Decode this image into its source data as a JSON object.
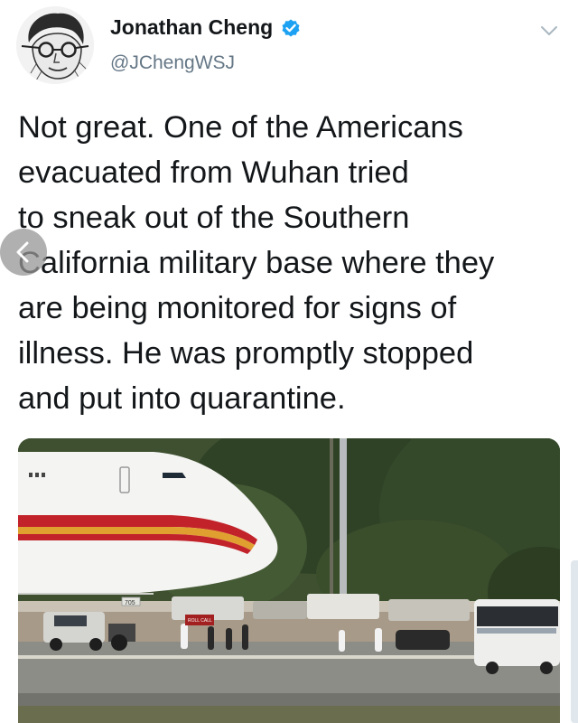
{
  "author": {
    "name": "Jonathan Cheng",
    "handle": "@JChengWSJ",
    "verified": true
  },
  "tweet": {
    "lines": [
      "Not great. One of the Americans",
      "evacuated from Wuhan tried",
      "to sneak out of the Southern",
      "California military base where they",
      "are being monitored for signs of",
      "illness. He was promptly stopped",
      "and put into quarantine."
    ]
  },
  "media": {
    "aircraft_tail_number": "705",
    "sign_text": "ROLL CALL"
  },
  "colors": {
    "verified_blue": "#1da1f2",
    "handle_gray": "#657786",
    "text": "#14171a",
    "plane_stripe_red": "#c2232b",
    "plane_stripe_gold": "#e0a030"
  },
  "icons": {
    "verified": "verified-badge-icon",
    "menu": "chevron-down-icon",
    "back": "back-arrow-icon"
  }
}
